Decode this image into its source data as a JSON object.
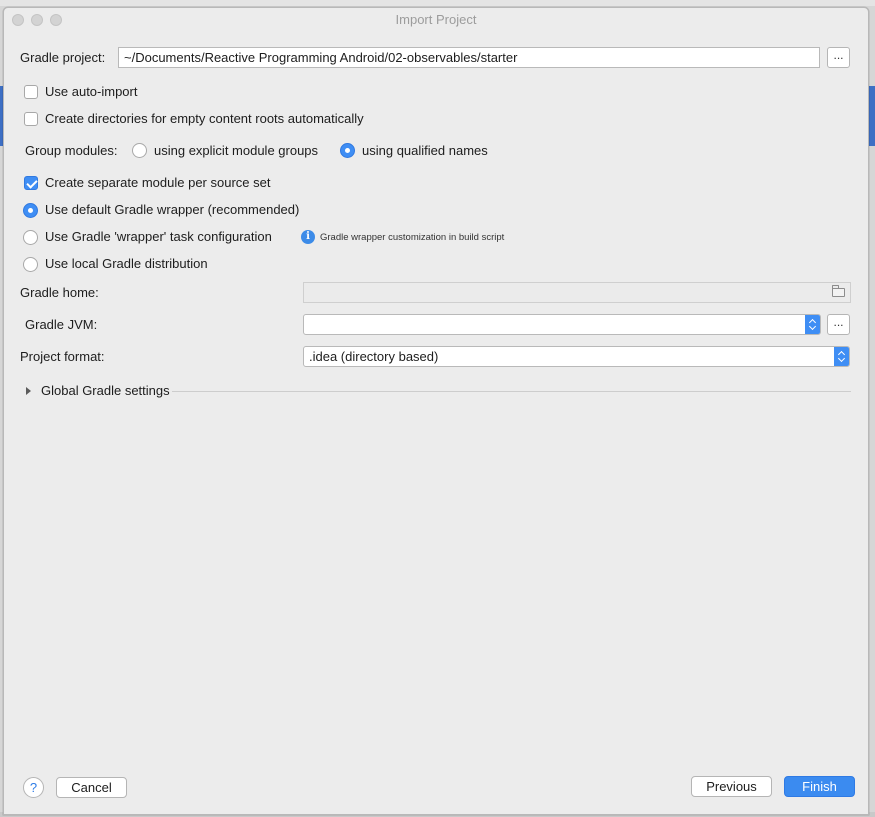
{
  "window": {
    "title": "Import Project"
  },
  "gradle_project": {
    "label": "Gradle project:",
    "value": "~/Documents/Reactive Programming Android/02-observables/starter",
    "browse_label": "..."
  },
  "options": {
    "auto_import": {
      "label": "Use auto-import",
      "checked": false
    },
    "create_dirs": {
      "label": "Create directories for empty content roots automatically",
      "checked": false
    }
  },
  "group_modules": {
    "label": "Group modules:",
    "option_explicit": "using explicit module groups",
    "option_qualified": "using qualified names",
    "selected": "qualified"
  },
  "separate_module": {
    "label": "Create separate module per source set",
    "checked": true
  },
  "distribution": {
    "default_wrapper": "Use default Gradle wrapper (recommended)",
    "wrapper_task": "Use Gradle 'wrapper' task configuration",
    "wrapper_hint": "Gradle wrapper customization in build script",
    "local": "Use local Gradle distribution",
    "selected": "default_wrapper"
  },
  "gradle_home": {
    "label": "Gradle home:",
    "value": ""
  },
  "gradle_jvm": {
    "label": "Gradle JVM:",
    "value": "",
    "browse_label": "..."
  },
  "project_format": {
    "label": "Project format:",
    "value": ".idea (directory based)"
  },
  "global_settings": {
    "label": "Global Gradle settings"
  },
  "footer": {
    "help_label": "?",
    "cancel_label": "Cancel",
    "previous_label": "Previous",
    "finish_label": "Finish"
  },
  "colors": {
    "accent": "#3f8ef4",
    "title_text": "#9c9c9c",
    "background": "#ececec"
  },
  "icons": [
    "info-icon",
    "folder-icon",
    "disclosure-triangle-icon",
    "help-icon",
    "select-arrows-icon"
  ]
}
